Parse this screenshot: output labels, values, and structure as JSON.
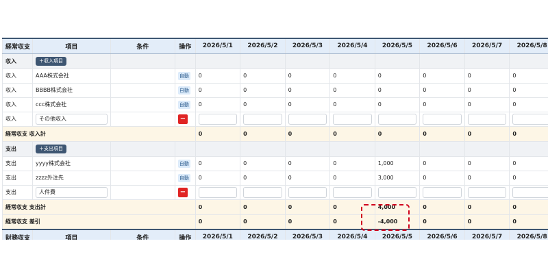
{
  "header": {
    "col_type": "経常収支",
    "col_item": "項目",
    "col_cond": "条件",
    "col_op": "操作",
    "dates": [
      "2026/5/1",
      "2026/5/2",
      "2026/5/3",
      "2026/5/4",
      "2026/5/5",
      "2026/5/6",
      "2026/5/7",
      "2026/5/8"
    ]
  },
  "footer_header": {
    "col_type": "財務収支",
    "col_item": "項目",
    "col_cond": "条件",
    "col_op": "操作"
  },
  "income": {
    "section_label": "収入",
    "add_button": "＋収入項目",
    "rows": [
      {
        "type": "収入",
        "item": "AAA株式会社",
        "auto": "自動",
        "values": [
          "0",
          "0",
          "0",
          "0",
          "0",
          "0",
          "0",
          "0"
        ]
      },
      {
        "type": "収入",
        "item": "BBBB株式会社",
        "auto": "自動",
        "values": [
          "0",
          "0",
          "0",
          "0",
          "0",
          "0",
          "0",
          "0"
        ]
      },
      {
        "type": "収入",
        "item": "ccc株式会社",
        "auto": "自動",
        "values": [
          "0",
          "0",
          "0",
          "0",
          "0",
          "0",
          "0",
          "0"
        ]
      }
    ],
    "input_row": {
      "type": "収入",
      "item": "その他収入",
      "remove": "−"
    },
    "total_label": "経常収支 収入計",
    "totals": [
      "0",
      "0",
      "0",
      "0",
      "0",
      "0",
      "0",
      "0"
    ]
  },
  "expense": {
    "section_label": "支出",
    "add_button": "＋支出項目",
    "rows": [
      {
        "type": "支出",
        "item": "yyyy株式会社",
        "auto": "自動",
        "values": [
          "0",
          "0",
          "0",
          "0",
          "1,000",
          "0",
          "0",
          "0"
        ]
      },
      {
        "type": "支出",
        "item": "zzzz外注先",
        "auto": "自動",
        "values": [
          "0",
          "0",
          "0",
          "0",
          "3,000",
          "0",
          "0",
          "0"
        ]
      }
    ],
    "input_row": {
      "type": "支出",
      "item": "人件費",
      "remove": "−"
    },
    "total_label": "経常収支 支出計",
    "totals": [
      "0",
      "0",
      "0",
      "0",
      "4,000",
      "0",
      "0",
      "0"
    ]
  },
  "diff": {
    "label": "経常収支 差引",
    "values": [
      "0",
      "0",
      "0",
      "0",
      "-4,000",
      "0",
      "0",
      "0"
    ]
  },
  "colors": {
    "header_bg": "#e3edf9",
    "accent": "#3e5672",
    "danger": "#e02424",
    "highlight": "#d0021b",
    "total_bg": "#fdf6e6"
  }
}
